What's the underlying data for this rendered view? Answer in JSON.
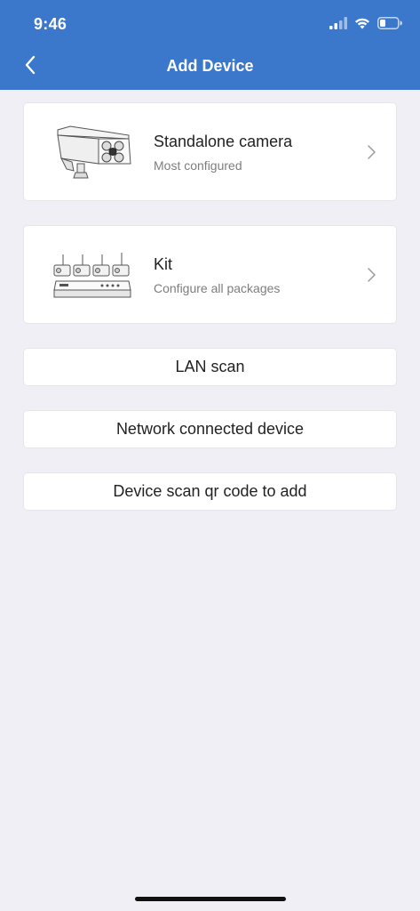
{
  "status_bar": {
    "time": "9:46"
  },
  "nav": {
    "title": "Add Device",
    "back_icon": "chevron-left-icon"
  },
  "devices": [
    {
      "title": "Standalone camera",
      "subtitle": "Most configured",
      "icon": "bullet-camera-icon"
    },
    {
      "title": "Kit",
      "subtitle": "Configure all packages",
      "icon": "camera-kit-icon"
    }
  ],
  "options": [
    {
      "label": "LAN scan"
    },
    {
      "label": "Network connected device"
    },
    {
      "label": "Device scan qr code to add"
    }
  ],
  "colors": {
    "header": "#3b78cc",
    "background": "#f0eff5",
    "card": "#ffffff"
  }
}
